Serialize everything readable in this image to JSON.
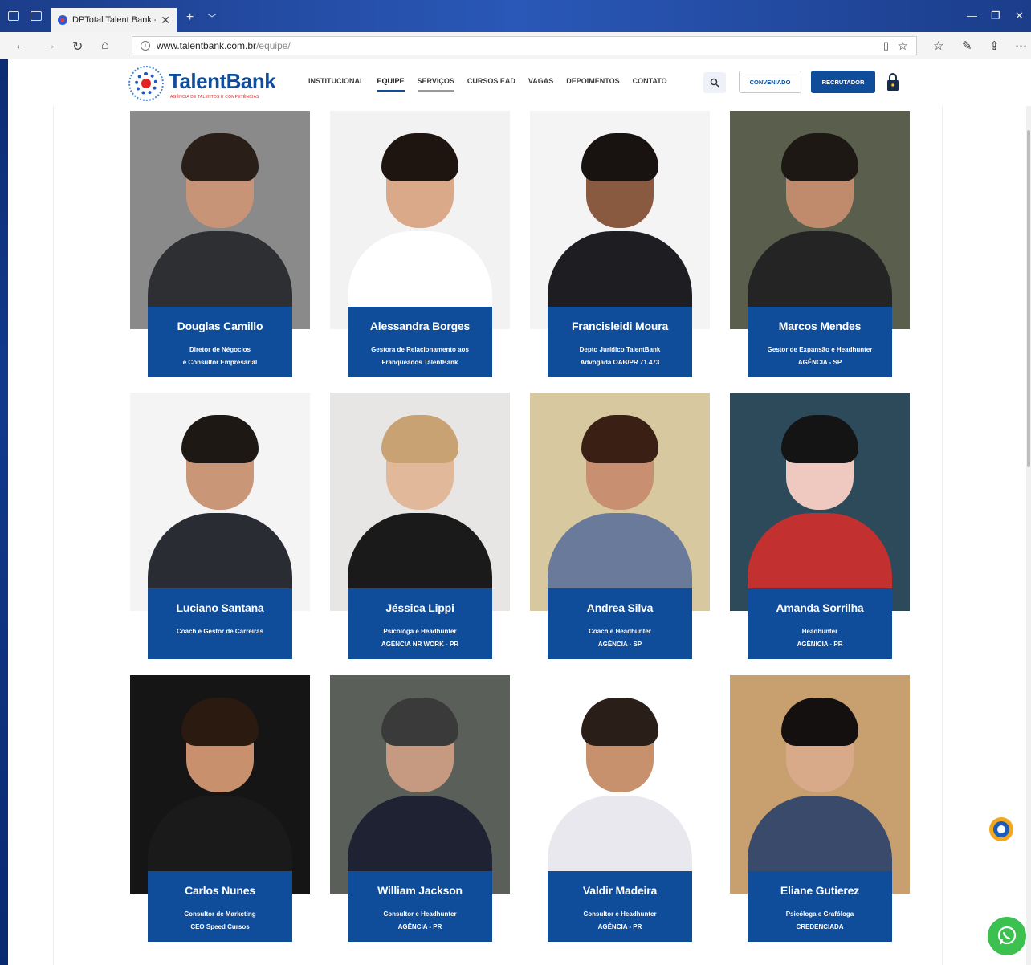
{
  "browser": {
    "tab_title": "DPTotal Talent Bank - EC",
    "url_host": "www.talentbank.com.br",
    "url_path": "/equipe/"
  },
  "site": {
    "logo_name": "TalentBank",
    "logo_tagline": "AGÊNCIA DE TALENTOS E COMPETÊNCIAS",
    "menu": [
      "INSTITUCIONAL",
      "EQUIPE",
      "SERVIÇOS",
      "CURSOS EAD",
      "VAGAS",
      "DEPOIMENTOS",
      "CONTATO"
    ],
    "conveniado_label": "CONVENIADO",
    "recrutador_label": "RECRUTADOR"
  },
  "colors": {
    "brand_blue": "#0f4c9a",
    "accent_red": "#e02424",
    "whatsapp_green": "#3cc150"
  },
  "team": [
    {
      "name": "Douglas Camillo",
      "role1": "Diretor de Négocios",
      "role2": "e Consultor Empresarial",
      "bg": "#8a8a8a",
      "suit": "#2e2f33",
      "skin": "#c89478",
      "hair": "#2a1e18"
    },
    {
      "name": "Alessandra Borges",
      "role1": "Gestora de Relacionamento aos",
      "role2": "Franqueados TalentBank",
      "bg": "#f2f2f2",
      "suit": "#ffffff",
      "skin": "#d9a98a",
      "hair": "#1e1410"
    },
    {
      "name": "Francisleidi Moura",
      "role1": "Depto Jurídico TalentBank",
      "role2": "Advogada OAB/PR 71.473",
      "bg": "#f4f4f4",
      "suit": "#1d1d22",
      "skin": "#8a5a40",
      "hair": "#181210"
    },
    {
      "name": "Marcos Mendes",
      "role1": "Gestor de Expansão e Headhunter",
      "role2": "AGÊNCIA - SP",
      "bg": "#5a5e4c",
      "suit": "#242424",
      "skin": "#c08a6c",
      "hair": "#1e1814"
    },
    {
      "name": "Luciano Santana",
      "role1": "Coach e Gestor de Carreiras",
      "role2": "",
      "bg": "#f4f4f4",
      "suit": "#2a2c33",
      "skin": "#c99678",
      "hair": "#1e1814"
    },
    {
      "name": "Jéssica Lippi",
      "role1": "Psicológa e Headhunter",
      "role2": "AGÊNCIA NR WORK - PR",
      "bg": "#e8e6e4",
      "suit": "#1a1a1a",
      "skin": "#e2b89a",
      "hair": "#c8a272"
    },
    {
      "name": "Andrea Silva",
      "role1": "Coach e Headhunter",
      "role2": "AGÊNCIA - SP",
      "bg": "#d8c8a0",
      "suit": "#6a7a9a",
      "skin": "#c89070",
      "hair": "#3a2014"
    },
    {
      "name": "Amanda Sorrilha",
      "role1": "Headhunter",
      "role2": "AGÊNICIA - PR",
      "bg": "#2c4a5a",
      "suit": "#c23030",
      "skin": "#efc8c0",
      "hair": "#141414"
    },
    {
      "name": "Carlos Nunes",
      "role1": "Consultor de Marketing",
      "role2": "CEO Speed Cursos",
      "bg": "#151515",
      "suit": "#1a1a1a",
      "skin": "#c8906c",
      "hair": "#2a1a10"
    },
    {
      "name": "William Jackson",
      "role1": "Consultor e Headhunter",
      "role2": "AGÊNCIA - PR",
      "bg": "#5a5f5a",
      "suit": "#1e2233",
      "skin": "#c69a80",
      "hair": "#3a3a3a"
    },
    {
      "name": "Valdir Madeira",
      "role1": "Consultor e Headhunter",
      "role2": "AGÊNCIA - PR",
      "bg": "#ffffff",
      "suit": "#e8e8ee",
      "skin": "#c8916e",
      "hair": "#2a1e18"
    },
    {
      "name": "Eliane Gutierez",
      "role1": "Psicóloga e Grafóloga",
      "role2": "CREDENCIADA",
      "bg": "#c8a070",
      "suit": "#3a4a6a",
      "skin": "#d8aa8a",
      "hair": "#141010"
    }
  ]
}
